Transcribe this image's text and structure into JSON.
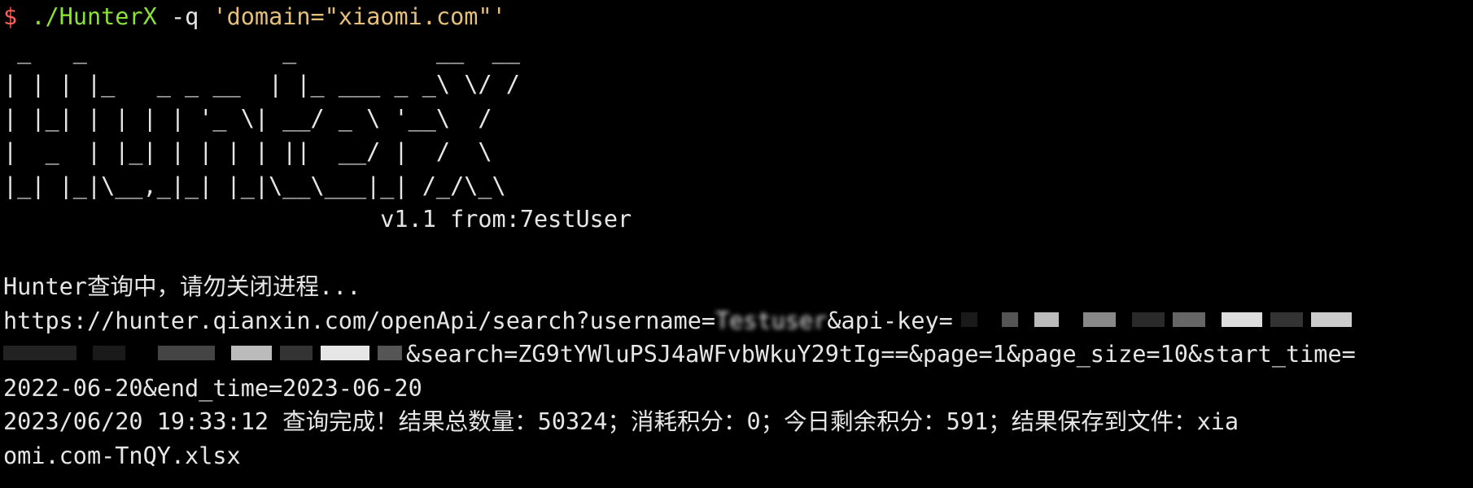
{
  "terminal": {
    "prompt_symbol": "$",
    "command_name": "./HunterX",
    "command_flag": "-q",
    "command_arg": "'domain=\"xiaomi.com\"'",
    "banner": [
      " _   _              _          __  __",
      "| | | |_   _ _ __  | |_ ___ _ _\\ \\/ /",
      "| |_| | | | | '_ \\| __/ _ \\ '__\\  /",
      "|  _  | |_| | | | | ||  __/ |  /  \\",
      "|_| |_|\\__,_|_| |_|\\__\\___|_| /_/\\_\\"
    ],
    "version_line": "                           v1.1 from:7estUser",
    "status_line": "Hunter查询中，请勿关闭进程...",
    "url_part1": "https://hunter.qianxin.com/openApi/search?username=",
    "url_username_partial": "Testuser",
    "url_part2": "&api-key=",
    "url_part3": "&search=ZG9tYWluPSJ4aWFvbWkuY29tIg==&page=1&page_size=10&start_time=",
    "url_part4": "2022-06-20&end_time=2023-06-20",
    "result_line1": "2023/06/20 19:33:12 查询完成！结果总数量：50324；消耗积分：0；今日剩余积分：591；结果保存到文件：xia",
    "result_line2": "omi.com-TnQY.xlsx"
  },
  "colors": {
    "background": "#000000",
    "text": "#e6e6e6",
    "prompt": "#ff5f56",
    "command": "#8ae234",
    "argument": "#e5c07b"
  }
}
